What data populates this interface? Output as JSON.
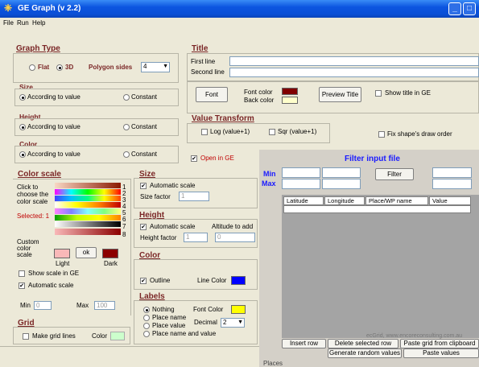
{
  "window": {
    "title": "GE Graph (v 2.2)"
  },
  "menu": {
    "items": [
      "File",
      "Run",
      "Help"
    ]
  },
  "graph_type": {
    "title": "Graph Type",
    "flat_label": "Flat",
    "three_d_label": "3D",
    "polygon_sides_label": "Polygon sides",
    "polygon_sides_value": "4"
  },
  "size_box": {
    "title": "Size",
    "opt1": "According to value",
    "opt2": "Constant"
  },
  "height_box": {
    "title": "Height",
    "opt1": "According to value",
    "opt2": "Constant"
  },
  "color_box": {
    "title": "Color",
    "opt1": "According to value",
    "opt2": "Constant"
  },
  "title_section": {
    "title": "Title",
    "first_line_label": "First line",
    "second_line_label": "Second line",
    "first_line_value": "",
    "second_line_value": "",
    "font_button": "Font",
    "font_color_label": "Font color",
    "back_color_label": "Back color",
    "font_color": "#800000",
    "back_color": "#ffffcc",
    "preview_button": "Preview Title",
    "show_title_label": "Show title in GE"
  },
  "value_transform": {
    "title": "Value Transform",
    "log_label": "Log (value+1)",
    "sqr_label": "Sqr (value+1)",
    "fix_shape_label": "Fix shape's draw order"
  },
  "open_in_ge": "Open in GE",
  "color_scale": {
    "title": "Color scale",
    "click_text": "Click to choose the color scale",
    "selected_text": "Selected: 1",
    "numbers": [
      "1",
      "2",
      "3",
      "4",
      "5",
      "6",
      "7",
      "8"
    ],
    "custom_label": "Custom color scale",
    "ok_button": "ok",
    "light_label": "Light",
    "dark_label": "Dark",
    "light_color": "#f9b8b8",
    "dark_color": "#8b0000",
    "show_scale_label": "Show scale in GE",
    "auto_scale_label": "Automatic scale",
    "min_label": "Min",
    "max_label": "Max",
    "min_value": "0",
    "max_value": "100"
  },
  "grid": {
    "title": "Grid",
    "make_lines_label": "Make grid lines",
    "color_label": "Color",
    "color": "#ccffcc"
  },
  "size_section": {
    "title": "Size",
    "auto_label": "Automatic scale",
    "factor_label": "Size factor",
    "factor_value": "1"
  },
  "height_section": {
    "title": "Height",
    "auto_label": "Automatic scale",
    "altitude_label": "Altitude to add",
    "factor_label": "Height factor",
    "factor_value": "1",
    "altitude_value": "0"
  },
  "color_section": {
    "title": "Color",
    "outline_label": "Outline",
    "line_color_label": "Line Color",
    "line_color": "#0000ff"
  },
  "labels_section": {
    "title": "Labels",
    "nothing": "Nothing",
    "font_color_label": "Font Color",
    "font_color": "#ffff00",
    "place_name": "Place name",
    "place_value": "Place value",
    "decimal_label": "Decimal",
    "decimal_value": "2",
    "place_name_value": "Place name and value"
  },
  "filter": {
    "title": "Filter input file",
    "min_label": "Min",
    "max_label": "Max",
    "filter_button": "Filter",
    "columns": [
      "Latitude",
      "Longitude",
      "Place/WP name",
      "Value"
    ],
    "credit": "ecGrid,  www.encoreconsulting.com.au",
    "insert_row": "Insert row",
    "delete_row": "Delete selected row",
    "paste_grid": "Paste grid from clipboard",
    "generate_random": "Generate random values",
    "paste_values": "Paste values",
    "places_label": "Places"
  }
}
